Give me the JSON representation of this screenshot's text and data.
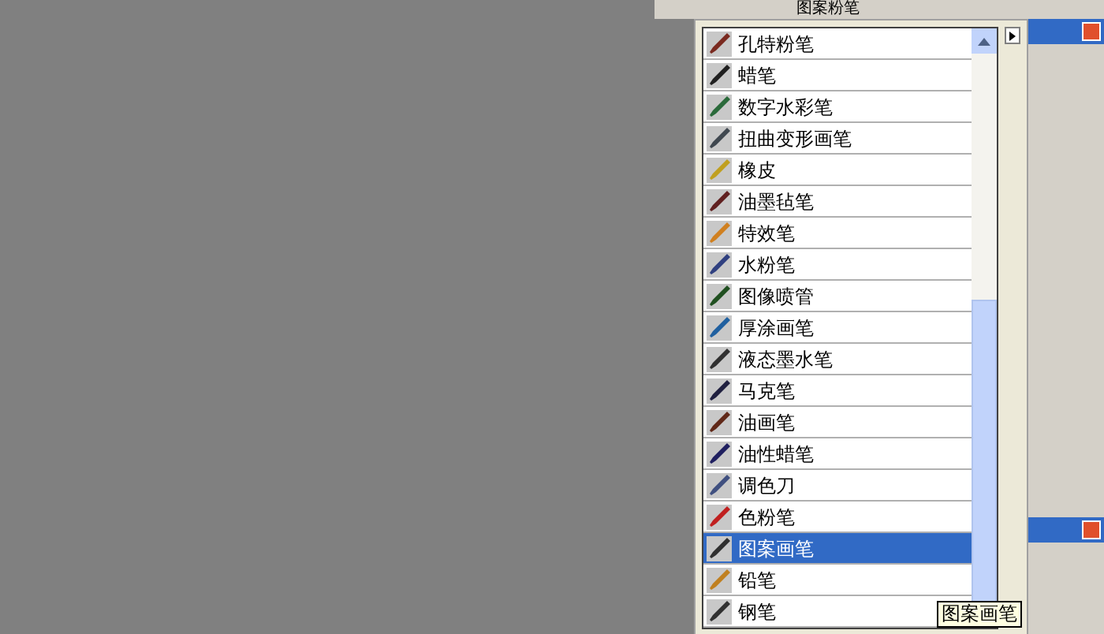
{
  "toolbar": {
    "brush_name": "图案粉笔"
  },
  "brush_menu": {
    "items": [
      {
        "label": "孔特粉笔",
        "selected": false
      },
      {
        "label": "蜡笔",
        "selected": false
      },
      {
        "label": "数字水彩笔",
        "selected": false
      },
      {
        "label": "扭曲变形画笔",
        "selected": false
      },
      {
        "label": "橡皮",
        "selected": false
      },
      {
        "label": "油墨毡笔",
        "selected": false
      },
      {
        "label": "特效笔",
        "selected": false
      },
      {
        "label": "水粉笔",
        "selected": false
      },
      {
        "label": "图像喷管",
        "selected": false
      },
      {
        "label": "厚涂画笔",
        "selected": false
      },
      {
        "label": "液态墨水笔",
        "selected": false
      },
      {
        "label": "马克笔",
        "selected": false
      },
      {
        "label": "油画笔",
        "selected": false
      },
      {
        "label": "油性蜡笔",
        "selected": false
      },
      {
        "label": "调色刀",
        "selected": false
      },
      {
        "label": "色粉笔",
        "selected": false
      },
      {
        "label": "图案画笔",
        "selected": true
      },
      {
        "label": "铅笔",
        "selected": false
      },
      {
        "label": "钢笔",
        "selected": false
      }
    ]
  },
  "tooltip": "图案画笔"
}
